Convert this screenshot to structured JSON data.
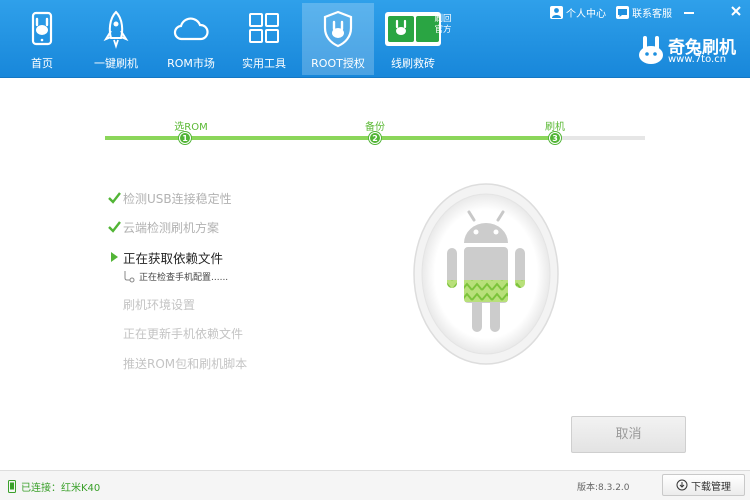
{
  "header": {
    "nav": [
      {
        "label": "首页",
        "icon": "phone-icon"
      },
      {
        "label": "一键刷机",
        "icon": "rocket-icon"
      },
      {
        "label": "ROM市场",
        "icon": "cloud-icon"
      },
      {
        "label": "实用工具",
        "icon": "grid-icon"
      },
      {
        "label": "ROOT授权",
        "icon": "rabbit-shield-icon"
      },
      {
        "label": "线刷救砖",
        "icon": "flash-official-icon"
      }
    ],
    "active_index": 4,
    "badge_line1": "刷回",
    "badge_line2": "官方",
    "user_center": "个人中心",
    "support": "联系客服",
    "brand_name": "奇兔刷机",
    "brand_url": "www.7to.cn"
  },
  "steps": [
    {
      "label": "选ROM",
      "num": "1"
    },
    {
      "label": "备份",
      "num": "2"
    },
    {
      "label": "刷机",
      "num": "3"
    }
  ],
  "tasks": [
    {
      "text": "检测USB连接稳定性",
      "state": "done"
    },
    {
      "text": "云端检测刷机方案",
      "state": "done"
    },
    {
      "text": "正在获取依赖文件",
      "state": "current"
    },
    {
      "text": "刷机环境设置",
      "state": "pending"
    },
    {
      "text": "正在更新手机依赖文件",
      "state": "pending"
    },
    {
      "text": "推送ROM包和刷机脚本",
      "state": "pending"
    }
  ],
  "sub_status": "正在检查手机配置......",
  "cancel_label": "取消",
  "status": {
    "connection": "已连接：红米K40",
    "version": "版本:8.3.2.0",
    "download_label": "下载管理"
  },
  "colors": {
    "header_blue": "#1e90df",
    "progress_green": "#8bd65a",
    "check_green": "#52b536"
  }
}
